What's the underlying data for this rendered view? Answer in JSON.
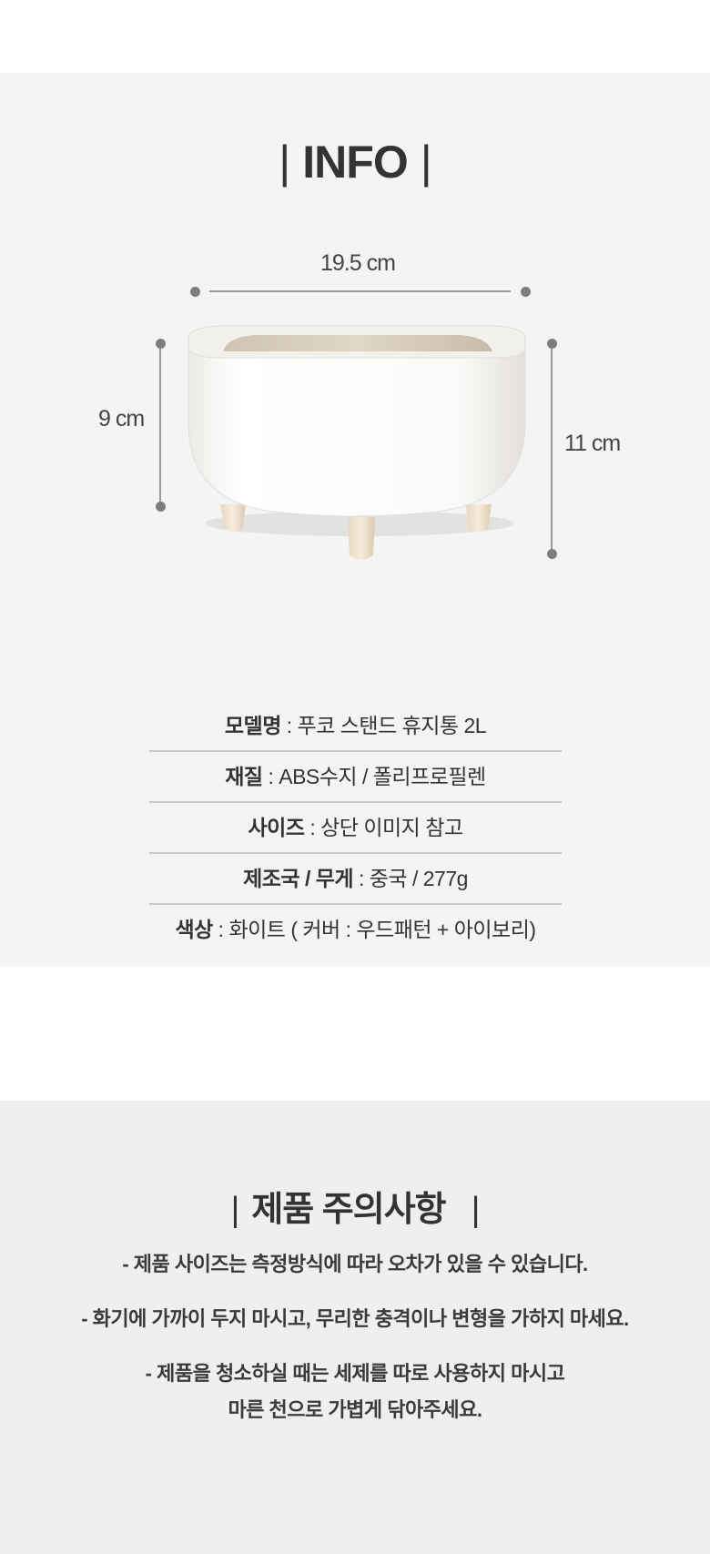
{
  "info_section": {
    "heading": "INFO",
    "dimensions": {
      "width_label": "19.5 cm",
      "body_height_label": "9 cm",
      "total_height_label": "11 cm"
    },
    "specs": [
      {
        "key": "모델명",
        "value": " : 푸코 스탠드 휴지통 2L"
      },
      {
        "key": "재질",
        "value": " : ABS수지 / 폴리프로필렌"
      },
      {
        "key": "사이즈",
        "value": " : 상단 이미지 참고"
      },
      {
        "key": "제조국 / 무게",
        "value": " : 중국 / 277g"
      },
      {
        "key": "색상",
        "value": " : 화이트 ( 커버 : 우드패턴 + 아이보리)"
      }
    ]
  },
  "caution_section": {
    "heading": "제품 주의사항",
    "items": [
      "- 제품 사이즈는 측정방식에 따라 오차가 있을 수 있습니다.",
      "- 화기에 가까이 두지 마시고, 무리한 충격이나 변형을 가하지 마세요.",
      "- 제품을 청소하실 때는 세제를 따로 사용하지 마시고",
      "마른 천으로 가볍게 닦아주세요."
    ]
  },
  "colors": {
    "info_background": "#f4f4f4",
    "caution_background": "#efefef",
    "text": "#333333",
    "divider": "#c9c9c9",
    "dimension_marker": "#7d7d7d"
  }
}
